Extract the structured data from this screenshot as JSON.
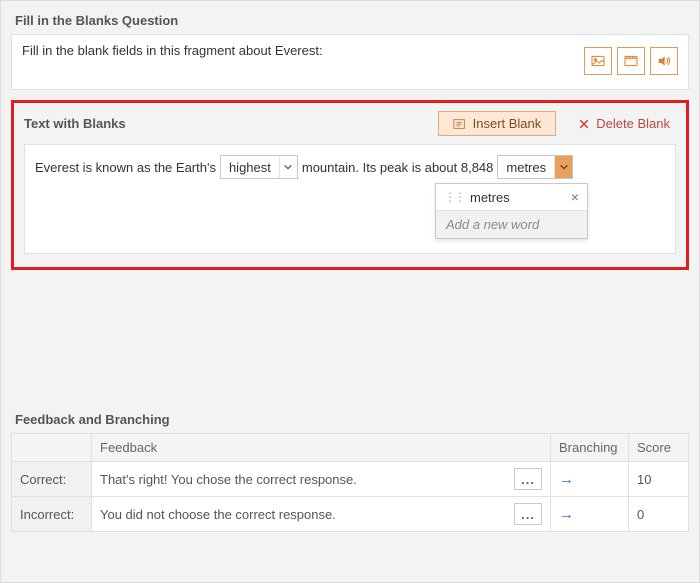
{
  "question": {
    "section_title": "Fill in the Blanks Question",
    "prompt": "Fill in the blank fields in this fragment about Everest:"
  },
  "blanks": {
    "section_title": "Text with Blanks",
    "insert_label": "Insert Blank",
    "delete_label": "Delete Blank",
    "text1": "Everest is known as the Earth's",
    "select1_value": "highest",
    "text2": "mountain. Its peak is about 8,848",
    "select2_value": "metres",
    "dropdown": {
      "option1": "metres",
      "add_placeholder": "Add a new word"
    }
  },
  "feedback": {
    "section_title": "Feedback and Branching",
    "headers": {
      "feedback": "Feedback",
      "branching": "Branching",
      "score": "Score"
    },
    "rows": {
      "correct": {
        "label": "Correct:",
        "text": "That's right! You chose the correct response.",
        "score": "10"
      },
      "incorrect": {
        "label": "Incorrect:",
        "text": "You did not choose the correct response.",
        "score": "0"
      }
    },
    "more": "...",
    "arrow": "→"
  }
}
